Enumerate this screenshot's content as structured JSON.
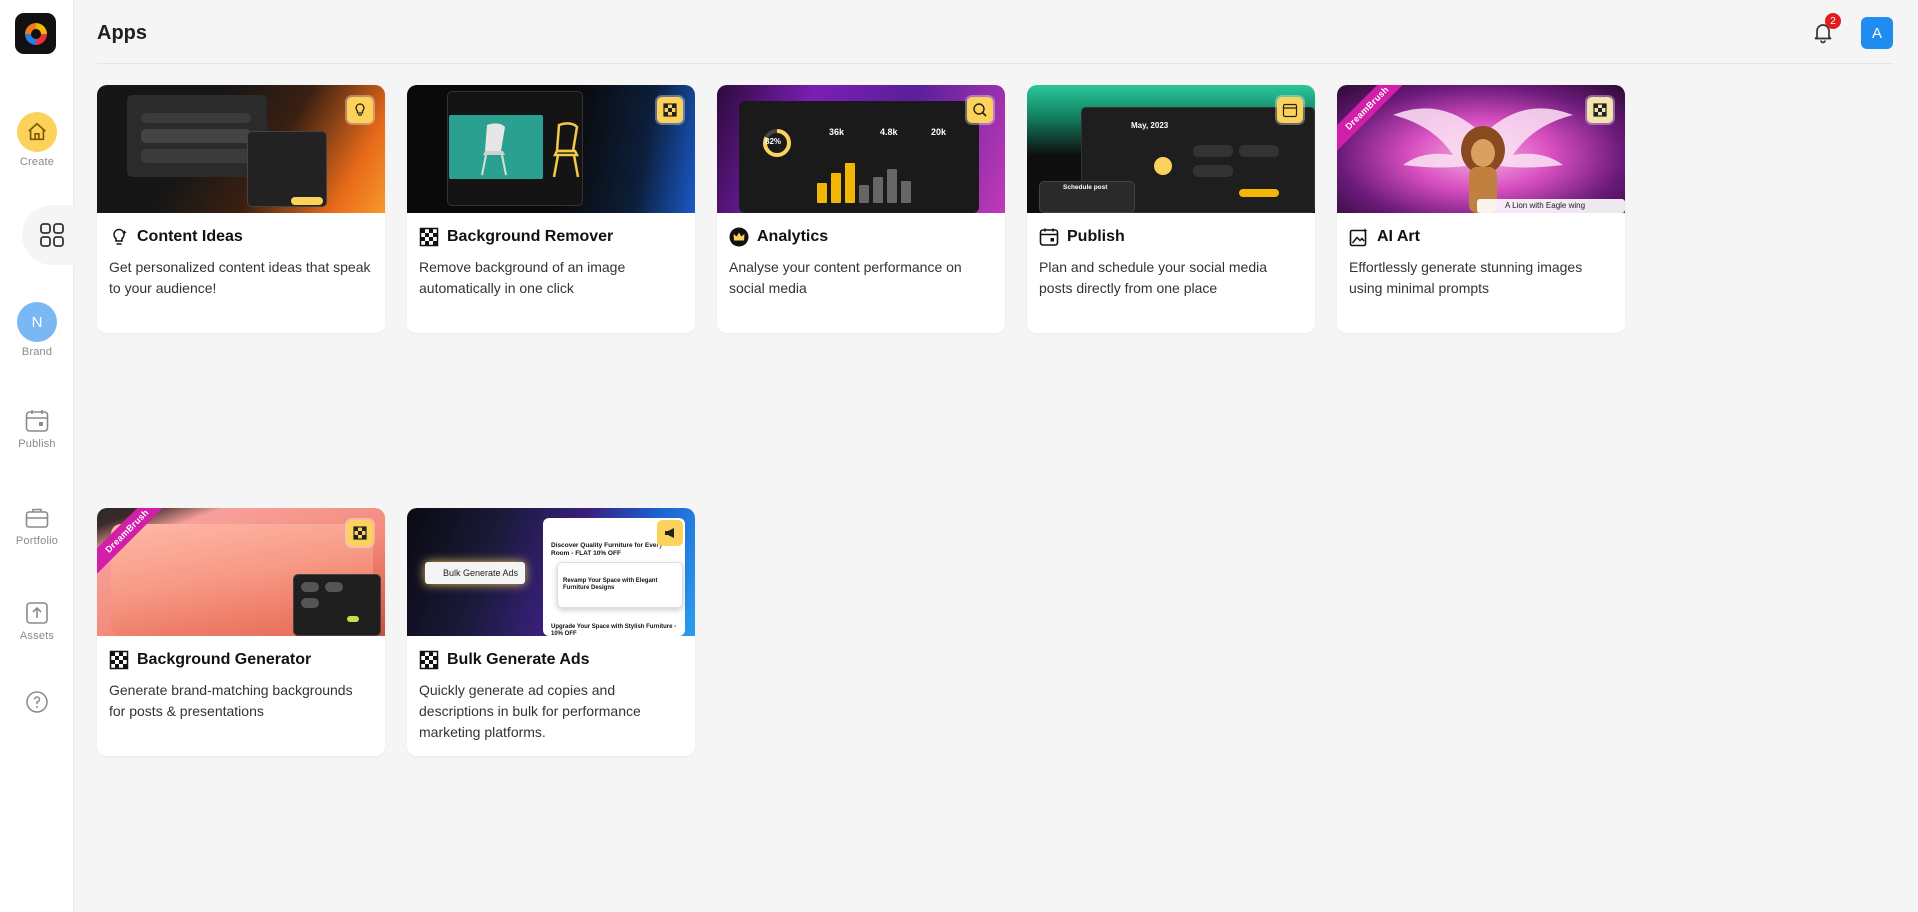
{
  "page": {
    "title": "Apps"
  },
  "header": {
    "notification_count": "2",
    "avatar_initial": "A"
  },
  "sidebar": {
    "items": [
      {
        "label": "Create"
      },
      {
        "label": ""
      },
      {
        "label": "Brand",
        "initial": "N"
      },
      {
        "label": "Publish"
      },
      {
        "label": "Portfolio"
      },
      {
        "label": "Assets"
      }
    ]
  },
  "colors": {
    "accent": "#fcd25a",
    "avatar": "#1f8cf0",
    "badge": "#e11d1d",
    "ribbon": "#d21ea8"
  },
  "apps": [
    {
      "title": "Content Ideas",
      "description": "Get personalized content ideas that speak to your audience!",
      "icon": "lightbulb-icon"
    },
    {
      "title": "Background Remover",
      "description": "Remove background of an image automatically in one click",
      "icon": "checker-icon"
    },
    {
      "title": "Analytics",
      "description": "Analyse your content performance on social media",
      "icon": "crown-icon"
    },
    {
      "title": "Publish",
      "description": "Plan and schedule your social media posts directly from one place",
      "icon": "calendar-icon"
    },
    {
      "title": "AI Art",
      "description": "Effortlessly generate stunning images using minimal prompts",
      "icon": "sparkle-image-icon",
      "thumb_ribbon": "DreamBrush",
      "thumb_caption": "A Lion with Eagle wing"
    },
    {
      "title": "Background Generator",
      "description": "Generate brand-matching backgrounds for posts & presentations",
      "icon": "checker-icon",
      "thumb_ribbon": "DreamBrush"
    },
    {
      "title": "Bulk Generate Ads",
      "description": "Quickly generate ad copies and descriptions in bulk for performance marketing platforms.",
      "icon": "checker-icon",
      "thumb_label": "Bulk Generate Ads",
      "thumb_ad_1": "Discover Quality Furniture for Every Room - FLAT 10% OFF",
      "thumb_ad_2": "Revamp Your Space with Elegant Furniture Designs",
      "thumb_ad_3": "Upgrade Your Space with Stylish Furniture - 10% OFF"
    }
  ],
  "thumbs": {
    "publish_month": "May, 2023",
    "publish_post": "Schedule post",
    "analytics_percent": "82%",
    "analytics_stats": [
      "36k",
      "4.8k",
      "20k"
    ]
  }
}
